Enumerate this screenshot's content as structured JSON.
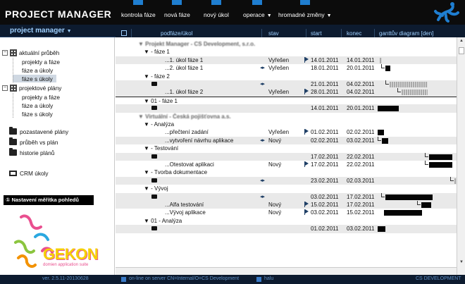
{
  "app": {
    "title": "PROJECT MANAGER"
  },
  "topnav": [
    {
      "label": "kontrola fáze",
      "caret": ""
    },
    {
      "label": "nová fáze",
      "caret": ""
    },
    {
      "label": "nový úkol",
      "caret": ""
    },
    {
      "label": "operace",
      "caret": "▼"
    },
    {
      "label": "hromadné změny",
      "caret": "▼"
    }
  ],
  "subbar": {
    "menu_label": "project manager",
    "caret": "▼"
  },
  "sidebar": {
    "groups": [
      {
        "label": "aktuální průběh",
        "toggle": "⊟",
        "children": [
          "projekty a fáze",
          "fáze a úkoly",
          "fáze s úkoly"
        ],
        "selected": 2
      },
      {
        "label": "projektové plány",
        "toggle": "⊟",
        "children": [
          "projekty a fáze",
          "fáze a úkoly",
          "fáze s úkoly"
        ],
        "selected": -1
      }
    ],
    "folders": [
      "pozastavené plány",
      "průběh vs plán",
      "historie plánů"
    ],
    "crm": "CRM úkoly",
    "scale_box": "Nastavení měřítka pohledů",
    "scale_icon": "①",
    "brand": {
      "name": "GEKON",
      "tagline": "domien application suite"
    }
  },
  "table": {
    "columns": {
      "task": "podfáze/úkol",
      "state": "stav",
      "start": "start",
      "end": "konec",
      "gantt": "ganttův diagram [den]"
    },
    "rows": [
      {
        "kind": "project",
        "text": "▼ Projekt Manager - CS Development, s.r.o.",
        "blur": true
      },
      {
        "kind": "phase",
        "text": "▼ - fáze 1"
      },
      {
        "kind": "task",
        "text": "...1. úkol fáze 1",
        "state": "Vyřešen",
        "icon": "flag",
        "start": "14.01.2011",
        "end": "14.01.2011",
        "bars": [
          {
            "f": 0.03,
            "w": 0.008,
            "t": "grey"
          }
        ]
      },
      {
        "kind": "task",
        "text": "...2. úkol fáze 1",
        "state": "Vyřešen",
        "icon": "arrows",
        "start": "18.01.2011",
        "end": "20.01.2011",
        "bars": [
          {
            "f": 0.1,
            "w": 0.06,
            "t": "black",
            "dep": true
          }
        ]
      },
      {
        "kind": "phase",
        "text": "▼ - fáze 2"
      },
      {
        "kind": "folder",
        "icon": "arrows",
        "start": "21.01.2011",
        "end": "04.02.2011",
        "bars": [
          {
            "f": 0.15,
            "w": 0.48,
            "t": "grey",
            "dep": true
          }
        ]
      },
      {
        "kind": "task",
        "text": "...1. úkol fáze 2",
        "state": "Vyřešen",
        "icon": "flag",
        "start": "28.01.2011",
        "end": "04.02.2011",
        "bars": [
          {
            "f": 0.3,
            "w": 0.33,
            "t": "grey",
            "dep": true
          }
        ]
      },
      {
        "kind": "phase",
        "text": "▼ 01 - fáze 1",
        "line": true
      },
      {
        "kind": "folder",
        "icon": "",
        "start": "14.01.2011",
        "end": "20.01.2011",
        "bars": [
          {
            "f": 0.0,
            "w": 0.27,
            "t": "black"
          }
        ]
      },
      {
        "kind": "project",
        "text": "▼ Virtuální - Česká pojišťovna a.s.",
        "blur": true
      },
      {
        "kind": "phase",
        "text": "▼ - Analýza"
      },
      {
        "kind": "task",
        "text": "...přečtení zadání",
        "state": "Vyřešen",
        "icon": "flag",
        "start": "01.02.2011",
        "end": "02.02.2011",
        "bars": [
          {
            "f": 0.0,
            "w": 0.08,
            "t": "black"
          }
        ]
      },
      {
        "kind": "task",
        "text": "...vytvoření návrhu aplikace",
        "state": "Nový",
        "icon": "arrows",
        "start": "02.02.2011",
        "end": "03.02.2011",
        "bars": [
          {
            "f": 0.05,
            "w": 0.08,
            "t": "black",
            "dep": true
          }
        ]
      },
      {
        "kind": "phase",
        "text": "▼ - Testování"
      },
      {
        "kind": "folder",
        "icon": "",
        "start": "17.02.2011",
        "end": "22.02.2011",
        "bars": [
          {
            "f": 0.65,
            "w": 0.3,
            "t": "black",
            "dep": true
          }
        ]
      },
      {
        "kind": "task",
        "text": "...Otestovat aplikaci",
        "state": "Nový",
        "icon": "flag",
        "start": "17.02.2011",
        "end": "22.02.2011",
        "bars": [
          {
            "f": 0.65,
            "w": 0.3,
            "t": "black",
            "dep": true
          }
        ]
      },
      {
        "kind": "phase",
        "text": "▼ - Tvorba dokumentace"
      },
      {
        "kind": "folder",
        "icon": "arrows",
        "start": "23.02.2011",
        "end": "02.03.2011",
        "bars": [
          {
            "f": 0.97,
            "w": 0.03,
            "t": "grey",
            "dep": true
          }
        ]
      },
      {
        "kind": "phase",
        "text": "▼ - Vývoj"
      },
      {
        "kind": "folder",
        "icon": "arrows",
        "start": "03.02.2011",
        "end": "17.02.2011",
        "bars": [
          {
            "f": 0.1,
            "w": 0.6,
            "t": "black",
            "dep": true
          }
        ]
      },
      {
        "kind": "task",
        "text": "...Alfa testování",
        "state": "Nový",
        "icon": "flag",
        "start": "15.02.2011",
        "end": "17.02.2011",
        "bars": [
          {
            "f": 0.55,
            "w": 0.13,
            "t": "black",
            "dep": true
          }
        ]
      },
      {
        "kind": "task",
        "text": "...Vývoj aplikace",
        "state": "Nový",
        "icon": "flag",
        "start": "03.02.2011",
        "end": "15.02.2011",
        "bars": [
          {
            "f": 0.08,
            "w": 0.48,
            "t": "black"
          }
        ]
      },
      {
        "kind": "phase",
        "text": "▼ 01 - Analýza"
      },
      {
        "kind": "folder",
        "icon": "",
        "start": "01.02.2011",
        "end": "03.02.2011",
        "bars": [
          {
            "f": 0.0,
            "w": 0.1,
            "t": "black"
          }
        ]
      }
    ]
  },
  "footer": {
    "version": "ver. 2.5.11-20130628",
    "server": "on-line on server CN=Internal/O=CS Development",
    "user": "halu",
    "company": "CS DEVELOPMENT"
  },
  "colors": {
    "accent": "#1f7ed0",
    "header_bg": "#0d1b2f",
    "header_text": "#9fd0ff"
  }
}
